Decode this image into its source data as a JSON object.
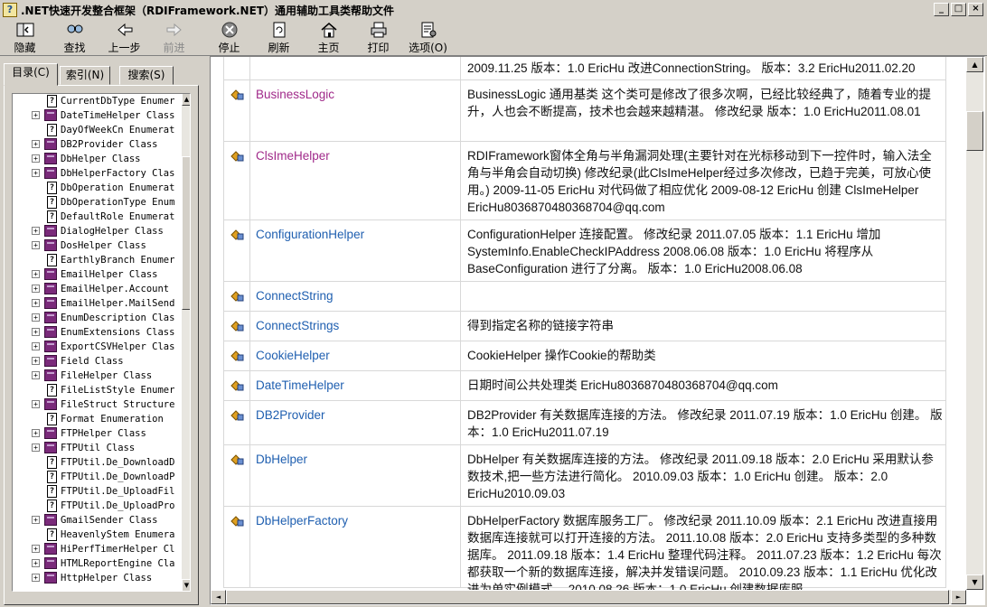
{
  "window": {
    "title": ".NET快速开发整合框架（RDIFramework.NET）通用辅助工具类帮助文件"
  },
  "toolbar": {
    "buttons": [
      {
        "label": "隐藏",
        "icon": "hide-icon",
        "enabled": true
      },
      {
        "label": "查找",
        "icon": "find-icon",
        "enabled": true
      },
      {
        "label": "上一步",
        "icon": "back-arrow-icon",
        "enabled": true
      },
      {
        "label": "前进",
        "icon": "forward-arrow-icon",
        "enabled": false
      },
      {
        "label": "停止",
        "icon": "stop-icon",
        "enabled": true
      },
      {
        "label": "刷新",
        "icon": "refresh-icon",
        "enabled": true
      },
      {
        "label": "主页",
        "icon": "home-icon",
        "enabled": true
      },
      {
        "label": "打印",
        "icon": "print-icon",
        "enabled": true
      },
      {
        "label": "选项(O)",
        "icon": "options-icon",
        "enabled": true
      }
    ]
  },
  "left_tabs": [
    {
      "label": "目录(C)",
      "active": true
    },
    {
      "label": "索引(N)",
      "active": false
    },
    {
      "label": "搜索(S)",
      "active": false
    }
  ],
  "tree": {
    "items": [
      {
        "label": "CurrentDbType Enumer",
        "type": "page",
        "expand": false
      },
      {
        "label": "DateTimeHelper Class",
        "type": "book",
        "expand": true
      },
      {
        "label": "DayOfWeekCn Enumerat",
        "type": "page",
        "expand": false
      },
      {
        "label": "DB2Provider Class",
        "type": "book",
        "expand": true
      },
      {
        "label": "DbHelper Class",
        "type": "book",
        "expand": true
      },
      {
        "label": "DbHelperFactory Clas",
        "type": "book",
        "expand": true
      },
      {
        "label": "DbOperation Enumerat",
        "type": "page",
        "expand": false
      },
      {
        "label": "DbOperationType Enum",
        "type": "page",
        "expand": false
      },
      {
        "label": "DefaultRole Enumerat",
        "type": "page",
        "expand": false
      },
      {
        "label": "DialogHelper Class",
        "type": "book",
        "expand": true
      },
      {
        "label": "DosHelper Class",
        "type": "book",
        "expand": true
      },
      {
        "label": "EarthlyBranch Enumer",
        "type": "page",
        "expand": false
      },
      {
        "label": "EmailHelper Class",
        "type": "book",
        "expand": true
      },
      {
        "label": "EmailHelper.Account",
        "type": "book",
        "expand": true
      },
      {
        "label": "EmailHelper.MailSend",
        "type": "book",
        "expand": true
      },
      {
        "label": "EnumDescription Clas",
        "type": "book",
        "expand": true
      },
      {
        "label": "EnumExtensions Class",
        "type": "book",
        "expand": true
      },
      {
        "label": "ExportCSVHelper Clas",
        "type": "book",
        "expand": true
      },
      {
        "label": "Field Class",
        "type": "book",
        "expand": true
      },
      {
        "label": "FileHelper Class",
        "type": "book",
        "expand": true
      },
      {
        "label": "FileListStyle Enumer",
        "type": "page",
        "expand": false
      },
      {
        "label": "FileStruct Structure",
        "type": "book",
        "expand": true
      },
      {
        "label": "Format Enumeration",
        "type": "page",
        "expand": false
      },
      {
        "label": "FTPHelper Class",
        "type": "book",
        "expand": true
      },
      {
        "label": "FTPUtil Class",
        "type": "book",
        "expand": true
      },
      {
        "label": "FTPUtil.De_DownloadD",
        "type": "page",
        "expand": false
      },
      {
        "label": "FTPUtil.De_DownloadP",
        "type": "page",
        "expand": false
      },
      {
        "label": "FTPUtil.De_UploadFil",
        "type": "page",
        "expand": false
      },
      {
        "label": "FTPUtil.De_UploadPro",
        "type": "page",
        "expand": false
      },
      {
        "label": "GmailSender Class",
        "type": "book",
        "expand": true
      },
      {
        "label": "HeavenlyStem Enumera",
        "type": "page",
        "expand": false
      },
      {
        "label": "HiPerfTimerHelper Cl",
        "type": "book",
        "expand": true
      },
      {
        "label": "HTMLReportEngine Cla",
        "type": "book",
        "expand": true
      },
      {
        "label": "HttpHelper Class",
        "type": "book",
        "expand": true
      }
    ]
  },
  "content": {
    "rows": [
      {
        "name": "",
        "desc": "2009.11.25 版本：1.0 EricHu 改进ConnectionString。 版本：3.2 EricHu2011.02.20",
        "visited": false,
        "lines": 1,
        "partial": true
      },
      {
        "name": "BusinessLogic",
        "desc": "BusinessLogic 通用基类 这个类可是修改了很多次啊，已经比较经典了，随着专业的提升，人也会不断提高，技术也会越来越精湛。 修改纪录 版本：1.0 EricHu2011.08.01",
        "visited": true,
        "lines": 3
      },
      {
        "name": "ClsImeHelper",
        "desc": "RDIFramework窗体全角与半角漏洞处理(主要针对在光标移动到下一控件时，输入法全角与半角会自动切换) 修改纪录(此ClsImeHelper经过多次修改，已趋于完美，可放心使用。) 2009-11-05 EricHu 对代码做了相应优化 2009-08-12 EricHu 创建 ClsImeHelper EricHu8036870480368704@qq.com",
        "visited": true,
        "lines": 4
      },
      {
        "name": "ConfigurationHelper",
        "desc": "ConfigurationHelper 连接配置。 修改纪录 2011.07.05 版本：1.1 EricHu 增加 SystemInfo.EnableCheckIPAddress 2008.06.08 版本：1.0 EricHu 将程序从 BaseConfiguration 进行了分离。 版本：1.0 EricHu2008.06.08",
        "visited": false,
        "lines": 3
      },
      {
        "name": "ConnectString",
        "desc": "",
        "visited": false,
        "lines": 1
      },
      {
        "name": "ConnectStrings",
        "desc": "得到指定名称的链接字符串",
        "visited": false,
        "lines": 1
      },
      {
        "name": "CookieHelper",
        "desc": "CookieHelper 操作Cookie的帮助类",
        "visited": false,
        "lines": 1
      },
      {
        "name": "DateTimeHelper",
        "desc": "日期时间公共处理类 EricHu8036870480368704@qq.com",
        "visited": false,
        "lines": 1
      },
      {
        "name": "DB2Provider",
        "desc": "DB2Provider 有关数据库连接的方法。 修改纪录 2011.07.19 版本：1.0 EricHu 创建。 版本：1.0 EricHu2011.07.19",
        "visited": false,
        "lines": 2
      },
      {
        "name": "DbHelper",
        "desc": "DbHelper 有关数据库连接的方法。 修改纪录 2011.09.18 版本：2.0 EricHu 采用默认参数技术,把一些方法进行简化。 2010.09.03 版本：1.0 EricHu 创建。 版本：2.0 EricHu2010.09.03",
        "visited": false,
        "lines": 3
      },
      {
        "name": "DbHelperFactory",
        "desc": "DbHelperFactory 数据库服务工厂。 修改纪录 2011.10.09 版本：2.1 EricHu 改进直接用数据库连接就可以打开连接的方法。 2011.10.08 版本：2.0 EricHu 支持多类型的多种数据库。 2011.09.18 版本：1.4 EricHu 整理代码注释。 2011.07.23 版本：1.2 EricHu 每次都获取一个新的数据库连接，解决并发错误问题。 2010.09.23 版本：1.1 EricHu 优化改进为单实例模式。 2010.08.26 版本：1.0 EricHu 创建数据库服",
        "visited": false,
        "lines": 5
      }
    ]
  }
}
